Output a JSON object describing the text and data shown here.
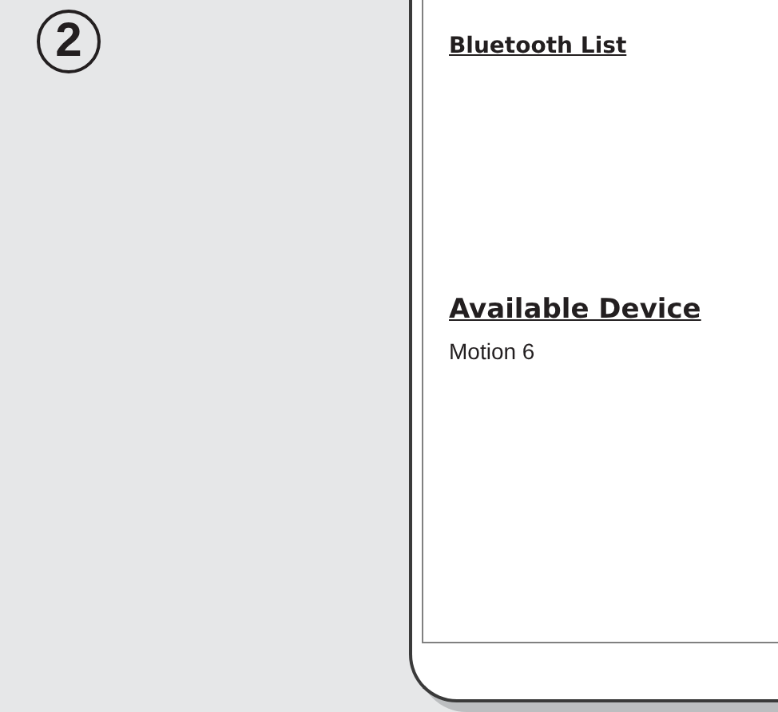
{
  "step": {
    "number": "2"
  },
  "screen": {
    "title": "Bluetooth List",
    "section": "Available Device",
    "devices": [
      {
        "name": "Motion 6"
      }
    ]
  }
}
